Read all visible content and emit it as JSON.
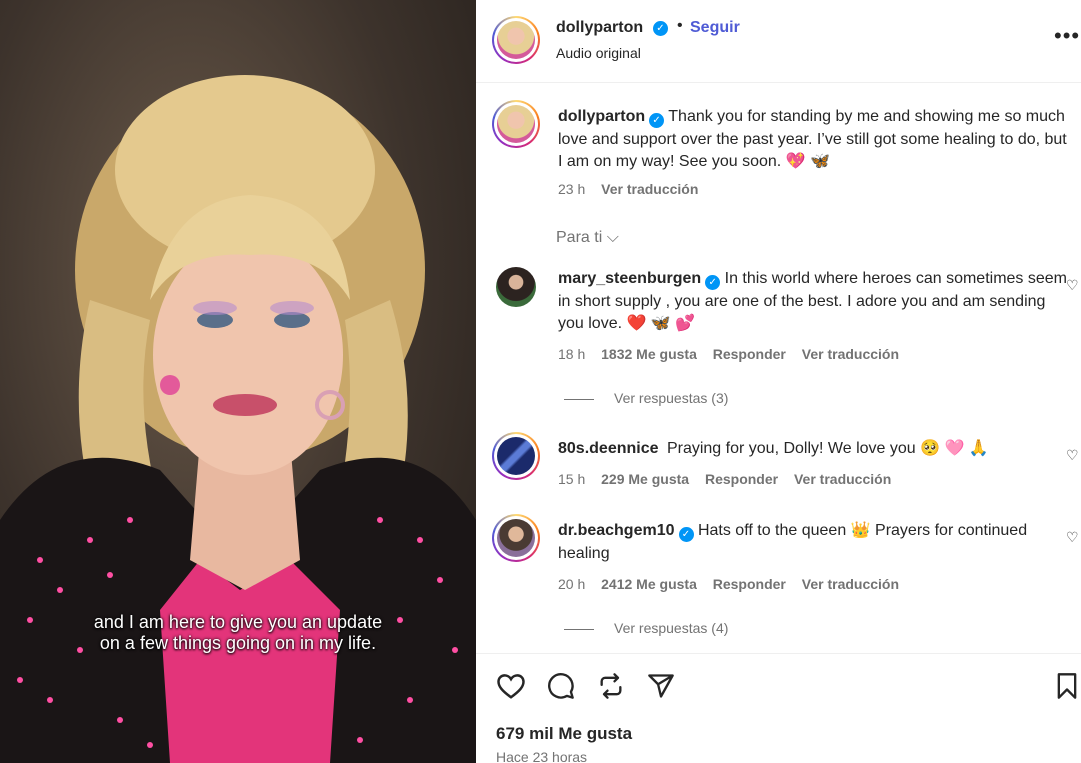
{
  "video": {
    "subtitle_line1": "and I am here to give you an update",
    "subtitle_line2": "on a few things going on in my life."
  },
  "header": {
    "username": "dollyparton",
    "separator": "•",
    "follow_label": "Seguir",
    "audio_label": "Audio original",
    "more_icon": "more-options-icon"
  },
  "caption": {
    "username": "dollyparton",
    "text": "Thank you for standing by me and showing me so much love and support over the past year. I’ve still got some healing to do, but I am on my way! See you soon. 💖 🦋",
    "time": "23 h",
    "translate": "Ver traducción"
  },
  "sort_label": "Para ti",
  "comments": [
    {
      "username": "mary_steenburgen",
      "verified": true,
      "text": "In this world where heroes can sometimes seem in short supply , you are one of the best. I adore you and am sending you love. ❤️ 🦋 💕",
      "time": "18 h",
      "likes": "1832 Me gusta",
      "reply": "Responder",
      "translate": "Ver traducción",
      "replies": "Ver respuestas (3)"
    },
    {
      "username": "80s.deennice",
      "verified": false,
      "text": "Praying for you, Dolly! We love you 🥺 🩷 🙏",
      "time": "15 h",
      "likes": "229 Me gusta",
      "reply": "Responder",
      "translate": "Ver traducción"
    },
    {
      "username": "dr.beachgem10",
      "verified": true,
      "text": "Hats off to the queen 👑 Prayers for continued healing",
      "time": "20 h",
      "likes": "2412 Me gusta",
      "reply": "Responder",
      "translate": "Ver traducción",
      "replies": "Ver respuestas (4)"
    }
  ],
  "footer": {
    "likes": "679 mil Me gusta",
    "time_ago": "Hace 23 horas"
  },
  "colors": {
    "accent": "#4f5bd5",
    "verified": "#0095f6",
    "muted": "#737373"
  }
}
